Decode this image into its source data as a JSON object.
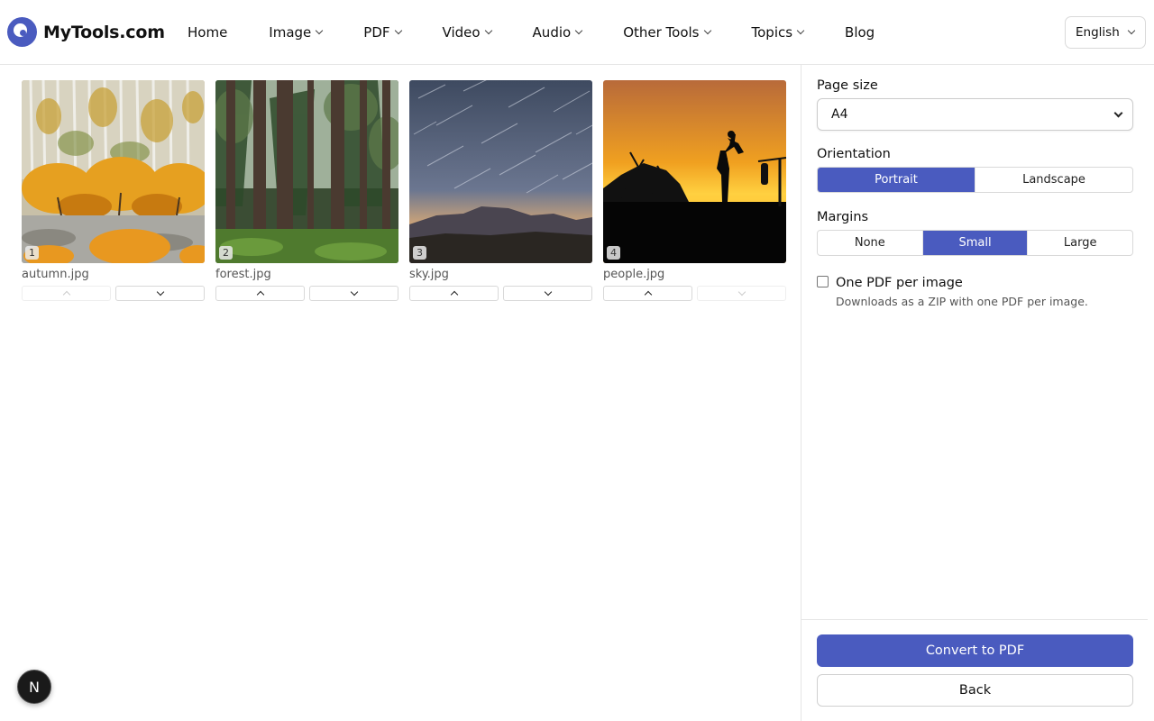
{
  "header": {
    "logo_text": "MyTools.com",
    "nav": [
      {
        "label": "Home",
        "has_dropdown": false
      },
      {
        "label": "Image",
        "has_dropdown": true
      },
      {
        "label": "PDF",
        "has_dropdown": true
      },
      {
        "label": "Video",
        "has_dropdown": true
      },
      {
        "label": "Audio",
        "has_dropdown": true
      },
      {
        "label": "Other Tools",
        "has_dropdown": true
      },
      {
        "label": "Topics",
        "has_dropdown": true
      },
      {
        "label": "Blog",
        "has_dropdown": false
      }
    ],
    "language": "English"
  },
  "images": [
    {
      "index": "1",
      "filename": "autumn.jpg",
      "up_disabled": true,
      "down_disabled": false
    },
    {
      "index": "2",
      "filename": "forest.jpg",
      "up_disabled": false,
      "down_disabled": false
    },
    {
      "index": "3",
      "filename": "sky.jpg",
      "up_disabled": false,
      "down_disabled": false
    },
    {
      "index": "4",
      "filename": "people.jpg",
      "up_disabled": false,
      "down_disabled": true
    }
  ],
  "settings": {
    "page_size_label": "Page size",
    "page_size_value": "A4",
    "orientation_label": "Orientation",
    "orientation_options": [
      "Portrait",
      "Landscape"
    ],
    "orientation_selected": "Portrait",
    "margins_label": "Margins",
    "margins_options": [
      "None",
      "Small",
      "Large"
    ],
    "margins_selected": "Small",
    "one_pdf_label": "One PDF per image",
    "one_pdf_checked": false,
    "one_pdf_help": "Downloads as a ZIP with one PDF per image."
  },
  "actions": {
    "convert_label": "Convert to PDF",
    "back_label": "Back"
  },
  "fab_label": "N",
  "colors": {
    "accent": "#4a5bbf"
  }
}
